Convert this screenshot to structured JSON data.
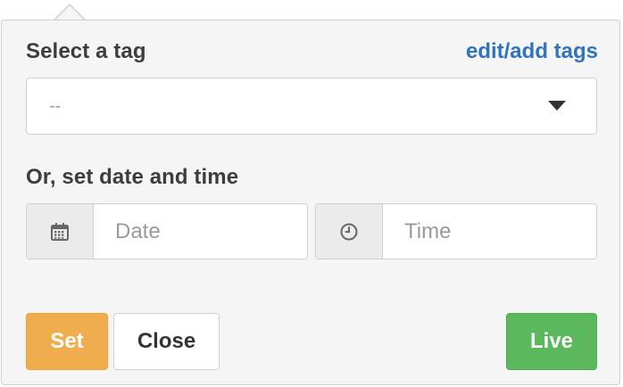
{
  "tag_section": {
    "label": "Select a tag",
    "edit_link": "edit/add tags",
    "select_value": "--"
  },
  "datetime_section": {
    "label": "Or, set date and time",
    "date_placeholder": "Date",
    "time_placeholder": "Time"
  },
  "buttons": {
    "set": "Set",
    "close": "Close",
    "live": "Live"
  },
  "icons": {
    "date": "calendar-icon",
    "time": "clock-icon",
    "select": "caret-down-icon"
  },
  "colors": {
    "set": "#f0ad4e",
    "live": "#5cb85c",
    "link": "#2f74bd"
  }
}
